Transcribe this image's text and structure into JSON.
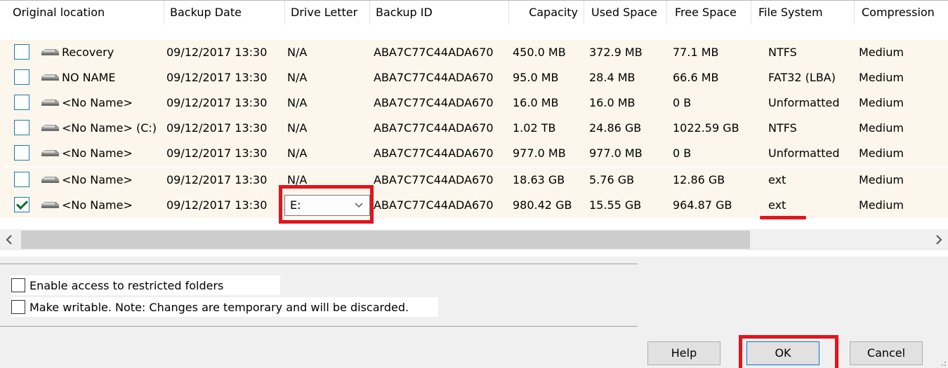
{
  "columns": [
    {
      "label": "Original location"
    },
    {
      "label": "Backup Date"
    },
    {
      "label": "Drive Letter"
    },
    {
      "label": "Backup ID"
    },
    {
      "label": "Capacity"
    },
    {
      "label": "Used Space"
    },
    {
      "label": "Free Space"
    },
    {
      "label": "File System"
    },
    {
      "label": "Compression"
    }
  ],
  "rows": [
    {
      "checked": false,
      "name": "Recovery",
      "date": "09/12/2017 13:30",
      "drive": "N/A",
      "id": "ABA7C77C44ADA670",
      "capacity": "450.0 MB",
      "used": "372.9 MB",
      "free": "77.1 MB",
      "fs": "NTFS",
      "compression": "Medium"
    },
    {
      "checked": false,
      "name": "NO NAME",
      "date": "09/12/2017 13:30",
      "drive": "N/A",
      "id": "ABA7C77C44ADA670",
      "capacity": "95.0 MB",
      "used": "28.4 MB",
      "free": "66.6 MB",
      "fs": "FAT32 (LBA)",
      "compression": "Medium"
    },
    {
      "checked": false,
      "name": "<No Name>",
      "date": "09/12/2017 13:30",
      "drive": "N/A",
      "id": "ABA7C77C44ADA670",
      "capacity": "16.0 MB",
      "used": "16.0 MB",
      "free": "0 B",
      "fs": "Unformatted",
      "compression": "Medium"
    },
    {
      "checked": false,
      "name": "<No Name> (C:)",
      "date": "09/12/2017 13:30",
      "drive": "N/A",
      "id": "ABA7C77C44ADA670",
      "capacity": "1.02 TB",
      "used": "24.86 GB",
      "free": "1022.59 GB",
      "fs": "NTFS",
      "compression": "Medium"
    },
    {
      "checked": false,
      "name": "<No Name>",
      "date": "09/12/2017 13:30",
      "drive": "N/A",
      "id": "ABA7C77C44ADA670",
      "capacity": "977.0 MB",
      "used": "977.0 MB",
      "free": "0 B",
      "fs": "Unformatted",
      "compression": "Medium"
    },
    {
      "checked": false,
      "name": "<No Name>",
      "date": "09/12/2017 13:30",
      "drive": "N/A",
      "id": "ABA7C77C44ADA670",
      "capacity": "18.63 GB",
      "used": "5.76 GB",
      "free": "12.86 GB",
      "fs": "ext",
      "compression": "Medium"
    },
    {
      "checked": true,
      "name": "<No Name>",
      "date": "09/12/2017 13:30",
      "drive": "E:",
      "id": "ABA7C77C44ADA670",
      "capacity": "980.42 GB",
      "used": "15.55 GB",
      "free": "964.87 GB",
      "fs": "ext",
      "compression": "Medium"
    }
  ],
  "options": {
    "restricted_label": "Enable access to restricted folders",
    "writable_label": "Make writable. Note: Changes are temporary and will be discarded."
  },
  "buttons": {
    "help": "Help",
    "ok": "OK",
    "cancel": "Cancel"
  },
  "colors": {
    "highlight": "#e2141c",
    "row_background": "#fdf6ec"
  }
}
